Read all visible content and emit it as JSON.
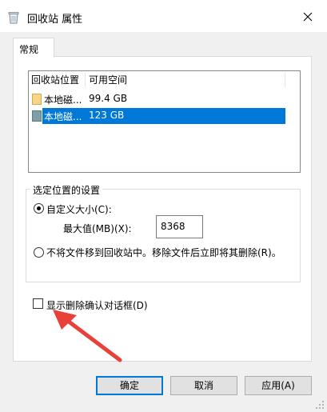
{
  "window": {
    "title": "回收站 属性",
    "icon": "recycle-bin-icon",
    "close_icon": "close-icon"
  },
  "tabs": [
    {
      "label": "常规",
      "active": true
    }
  ],
  "locations_list": {
    "columns": [
      "回收站位置",
      "可用空间"
    ],
    "rows": [
      {
        "location": "本地磁...",
        "free_space": "99.4 GB",
        "icon": "drive-icon",
        "selected": false
      },
      {
        "location": "本地磁...",
        "free_space": "123 GB",
        "icon": "drive-icon",
        "selected": true
      }
    ]
  },
  "settings": {
    "group_label": "选定位置的设置",
    "custom_size_label": "自定义大小(C):",
    "max_value_label": "最大值(MB)(X):",
    "max_value": "8368",
    "no_recycle_label": "不将文件移到回收站中。移除文件后立即将其删除(R)。",
    "selected_option": "custom_size"
  },
  "confirm_dialog": {
    "label": "显示删除确认对话框(D)",
    "checked": false
  },
  "buttons": {
    "ok": "确定",
    "cancel": "取消",
    "apply": "应用(A)"
  },
  "annotation": {
    "arrow_color": "#e8413a"
  },
  "colors": {
    "selection": "#0078d7",
    "client_bg": "#f0f0f0"
  }
}
